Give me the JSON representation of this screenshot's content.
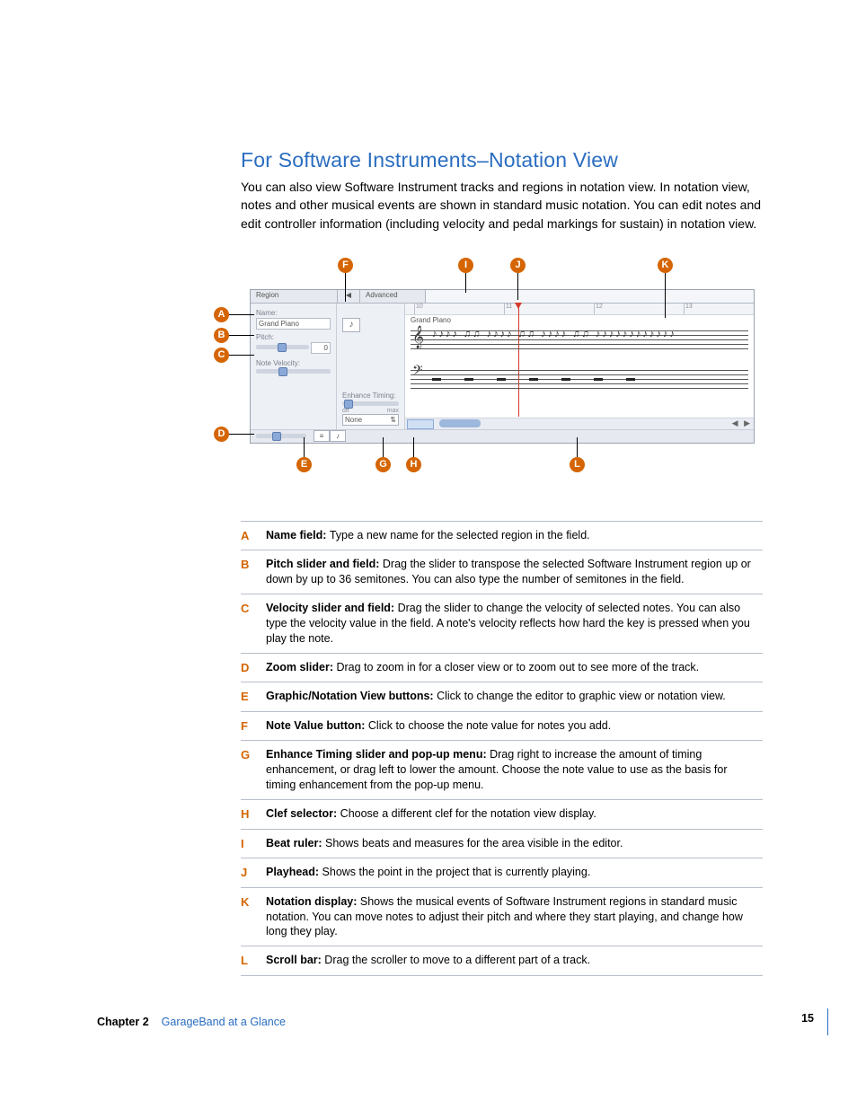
{
  "heading": "For Software Instruments–Notation View",
  "intro": "You can also view Software Instrument tracks and regions in notation view. In notation view, notes and other musical events are shown in standard music notation. You can edit notes and edit controller information (including velocity and pedal markings for sustain) in notation view.",
  "editor": {
    "header": {
      "region": "Region",
      "chev": "◀",
      "advanced": "Advanced"
    },
    "name_label": "Name:",
    "name_value": "Grand Piano",
    "pitch_label": "Pitch:",
    "pitch_value": "0",
    "velocity_label": "Note Velocity:",
    "note_value_glyph": "♪",
    "enhance_label": "Enhance Timing:",
    "enhance_off": "off",
    "enhance_max": "max",
    "enhance_menu": "None",
    "score_title": "Grand Piano",
    "ruler_marks": [
      "10",
      "11",
      "12",
      "13"
    ],
    "scroll_arrows": "◀ ▶"
  },
  "callouts": {
    "A": "A",
    "B": "B",
    "C": "C",
    "D": "D",
    "E": "E",
    "F": "F",
    "G": "G",
    "H": "H",
    "I": "I",
    "J": "J",
    "K": "K",
    "L": "L"
  },
  "table": [
    {
      "k": "A",
      "term": "Name field:",
      "desc": "Type a new name for the selected region in the field."
    },
    {
      "k": "B",
      "term": "Pitch slider and field:",
      "desc": "Drag the slider to transpose the selected Software Instrument region up or down by up to 36 semitones. You can also type the number of semitones in the field."
    },
    {
      "k": "C",
      "term": "Velocity slider and field:",
      "desc": "Drag the slider to change the velocity of selected notes. You can also type the velocity value in the field. A note's velocity reflects how hard the key is pressed when you play the note."
    },
    {
      "k": "D",
      "term": "Zoom slider:",
      "desc": "Drag to zoom in for a closer view or to zoom out to see more of the track."
    },
    {
      "k": "E",
      "term": "Graphic/Notation View buttons:",
      "desc": "Click to change the editor to graphic view or notation view."
    },
    {
      "k": "F",
      "term": "Note Value button:",
      "desc": "Click to choose the note value for notes you add."
    },
    {
      "k": "G",
      "term": "Enhance Timing slider and pop-up menu:",
      "desc": "Drag right to increase the amount of timing enhancement, or drag left to lower the amount. Choose the note value to use as the basis for timing enhancement from the pop-up menu."
    },
    {
      "k": "H",
      "term": "Clef selector:",
      "desc": "Choose a different clef for the notation view display."
    },
    {
      "k": "I",
      "term": "Beat ruler:",
      "desc": "Shows beats and measures for the area visible in the editor."
    },
    {
      "k": "J",
      "term": "Playhead:",
      "desc": "Shows the point in the project that is currently playing."
    },
    {
      "k": "K",
      "term": "Notation display:",
      "desc": "Shows the musical events of Software Instrument regions in standard music notation. You can move notes to adjust their pitch and where they start playing, and change how long they play."
    },
    {
      "k": "L",
      "term": "Scroll bar:",
      "desc": "Drag the scroller to move to a different part of a track."
    }
  ],
  "footer": {
    "chapter": "Chapter 2",
    "title": "GarageBand at a Glance",
    "page": "15"
  }
}
